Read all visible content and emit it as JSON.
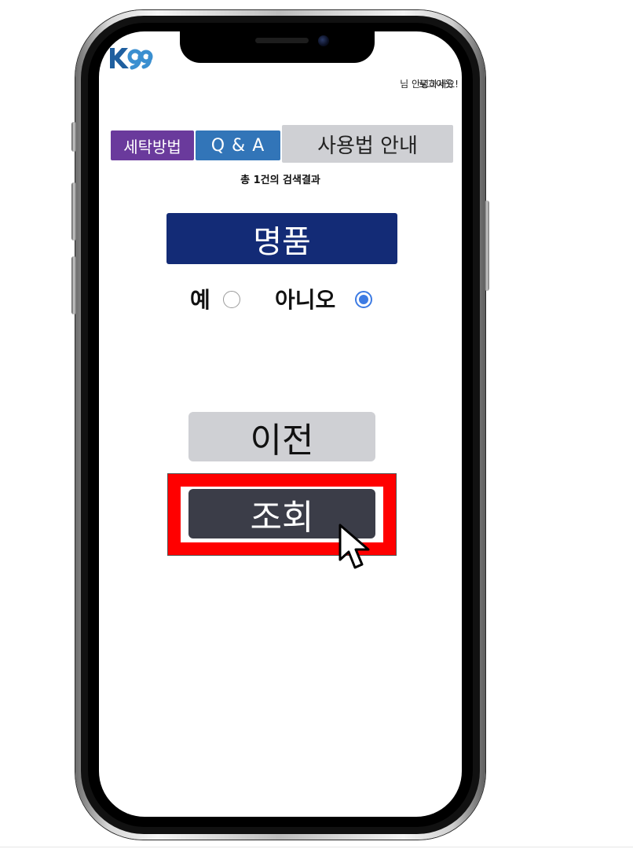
{
  "header": {
    "logo_text": "K99",
    "greeting": "님 안녕하세요!",
    "logout_label": "로그아웃"
  },
  "tabs": [
    {
      "label": "세탁방법",
      "color": "#6a3a9c"
    },
    {
      "label": "Q & A",
      "color": "#3275b8"
    },
    {
      "label": "사용법 안내",
      "color": "#cfd0d4"
    }
  ],
  "result_count": "총 1건의 검색결과",
  "category_label": "명품",
  "options": {
    "yes_label": "예",
    "no_label": "아니오",
    "selected": "아니오"
  },
  "buttons": {
    "prev_label": "이전",
    "query_label": "조회"
  },
  "colors": {
    "category_bg": "#132b76",
    "query_bg": "#3b3d48",
    "highlight": "#ff0000",
    "radio_accent": "#3d7be3"
  }
}
